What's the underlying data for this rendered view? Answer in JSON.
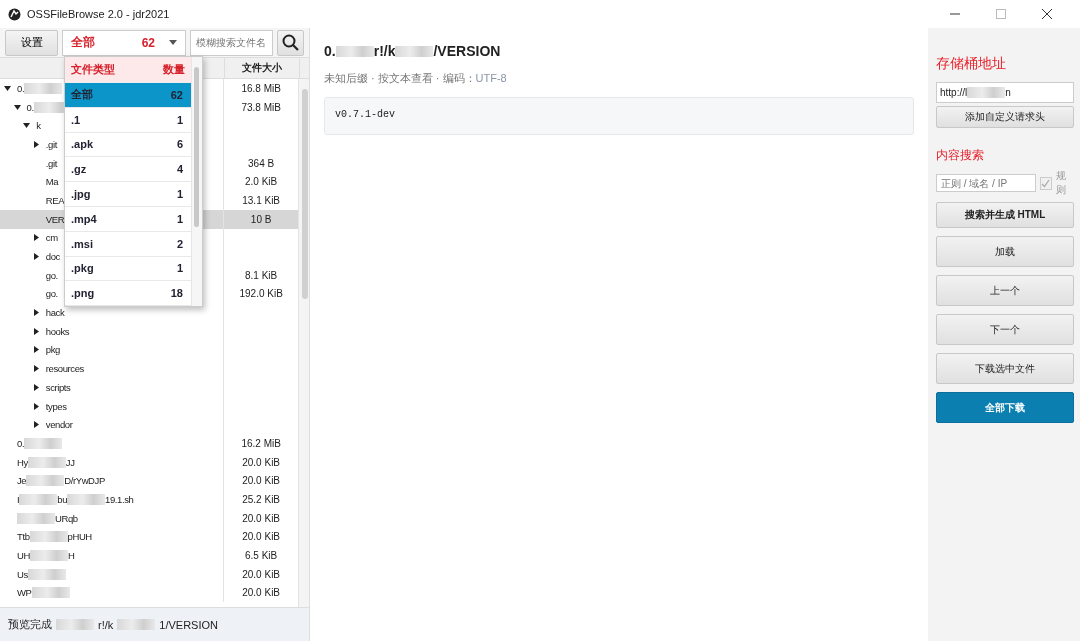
{
  "window": {
    "title": "OSSFileBrowse 2.0 - jdr2021"
  },
  "toolbar": {
    "settings_button": "设置",
    "type_combo": {
      "label": "全部",
      "count": "62"
    },
    "search": {
      "placeholder": "模糊搜索文件名"
    }
  },
  "type_dropdown": {
    "header": {
      "type": "文件类型",
      "count": "数量"
    },
    "items": [
      {
        "type": "全部",
        "count": "62",
        "selected": true
      },
      {
        "type": ".1",
        "count": "1",
        "selected": false
      },
      {
        "type": ".apk",
        "count": "6",
        "selected": false
      },
      {
        "type": ".gz",
        "count": "4",
        "selected": false
      },
      {
        "type": ".jpg",
        "count": "1",
        "selected": false
      },
      {
        "type": ".mp4",
        "count": "1",
        "selected": false
      },
      {
        "type": ".msi",
        "count": "2",
        "selected": false
      },
      {
        "type": ".pkg",
        "count": "1",
        "selected": false
      },
      {
        "type": ".png",
        "count": "18",
        "selected": false
      }
    ]
  },
  "file_table": {
    "columns": [
      "文件大小"
    ],
    "rows": [
      {
        "kind": "folder",
        "expanded": true,
        "selected": false,
        "size": "16.8 MiB",
        "segments": [
          {
            "kind": "text",
            "text": "0."
          },
          {
            "kind": "blur"
          }
        ],
        "children": [
          {
            "kind": "folder",
            "expanded": true,
            "selected": false,
            "size": "73.8 MiB",
            "segments": [
              {
                "kind": "text",
                "text": "0."
              },
              {
                "kind": "blur"
              }
            ],
            "children": [
              {
                "kind": "folder",
                "expanded": true,
                "selected": false,
                "segments": [
                  {
                    "kind": "text",
                    "text": "k"
                  }
                ],
                "children": [
                  {
                    "kind": "folder",
                    "expanded": false,
                    "selected": false,
                    "segments": [
                      {
                        "kind": "text",
                        "text": ".git"
                      }
                    ]
                  },
                  {
                    "kind": "file",
                    "selected": false,
                    "size": "364 B",
                    "segments": [
                      {
                        "kind": "text",
                        "text": ".git"
                      }
                    ]
                  },
                  {
                    "kind": "file",
                    "selected": false,
                    "size": "2.0 KiB",
                    "segments": [
                      {
                        "kind": "text",
                        "text": "Ma"
                      }
                    ]
                  },
                  {
                    "kind": "file",
                    "selected": false,
                    "size": "13.1 KiB",
                    "segments": [
                      {
                        "kind": "text",
                        "text": "REA"
                      }
                    ]
                  },
                  {
                    "kind": "file",
                    "selected": true,
                    "size": "10 B",
                    "segments": [
                      {
                        "kind": "text",
                        "text": "VER"
                      }
                    ]
                  },
                  {
                    "kind": "folder",
                    "expanded": false,
                    "selected": false,
                    "segments": [
                      {
                        "kind": "text",
                        "text": "cm"
                      }
                    ]
                  },
                  {
                    "kind": "folder",
                    "expanded": false,
                    "selected": false,
                    "segments": [
                      {
                        "kind": "text",
                        "text": "doc"
                      }
                    ]
                  },
                  {
                    "kind": "file",
                    "selected": false,
                    "size": "8.1 KiB",
                    "segments": [
                      {
                        "kind": "text",
                        "text": "go."
                      }
                    ]
                  },
                  {
                    "kind": "file",
                    "selected": false,
                    "size": "192.0 KiB",
                    "segments": [
                      {
                        "kind": "text",
                        "text": "go."
                      }
                    ]
                  },
                  {
                    "kind": "folder",
                    "expanded": false,
                    "selected": false,
                    "segments": [
                      {
                        "kind": "text",
                        "text": "hack"
                      }
                    ]
                  },
                  {
                    "kind": "folder",
                    "expanded": false,
                    "selected": false,
                    "segments": [
                      {
                        "kind": "text",
                        "text": "hooks"
                      }
                    ]
                  },
                  {
                    "kind": "folder",
                    "expanded": false,
                    "selected": false,
                    "segments": [
                      {
                        "kind": "text",
                        "text": "pkg"
                      }
                    ]
                  },
                  {
                    "kind": "folder",
                    "expanded": false,
                    "selected": false,
                    "segments": [
                      {
                        "kind": "text",
                        "text": "resources"
                      }
                    ]
                  },
                  {
                    "kind": "folder",
                    "expanded": false,
                    "selected": false,
                    "segments": [
                      {
                        "kind": "text",
                        "text": "scripts"
                      }
                    ]
                  },
                  {
                    "kind": "folder",
                    "expanded": false,
                    "selected": false,
                    "segments": [
                      {
                        "kind": "text",
                        "text": "types"
                      }
                    ]
                  },
                  {
                    "kind": "folder",
                    "expanded": false,
                    "selected": false,
                    "segments": [
                      {
                        "kind": "text",
                        "text": "vendor"
                      }
                    ]
                  }
                ]
              }
            ]
          }
        ]
      },
      {
        "kind": "file",
        "selected": false,
        "size": "16.2 MiB",
        "segments": [
          {
            "kind": "text",
            "text": "0."
          },
          {
            "kind": "blur"
          }
        ]
      },
      {
        "kind": "file",
        "selected": false,
        "size": "20.0 KiB",
        "segments": [
          {
            "kind": "text",
            "text": "Hy"
          },
          {
            "kind": "blur"
          },
          {
            "kind": "text",
            "text": "JJ"
          }
        ]
      },
      {
        "kind": "file",
        "selected": false,
        "size": "20.0 KiB",
        "segments": [
          {
            "kind": "text",
            "text": "Je"
          },
          {
            "kind": "blur"
          },
          {
            "kind": "text",
            "text": "D/rYwDJP"
          }
        ]
      },
      {
        "kind": "file",
        "selected": false,
        "size": "25.2 KiB",
        "segments": [
          {
            "kind": "text",
            "text": "I"
          },
          {
            "kind": "blur"
          },
          {
            "kind": "text",
            "text": "bu"
          },
          {
            "kind": "blur"
          },
          {
            "kind": "text",
            "text": "19.1.sh"
          }
        ]
      },
      {
        "kind": "file",
        "selected": false,
        "size": "20.0 KiB",
        "segments": [
          {
            "kind": "blur"
          },
          {
            "kind": "text",
            "text": "URqb"
          }
        ]
      },
      {
        "kind": "file",
        "selected": false,
        "size": "20.0 KiB",
        "segments": [
          {
            "kind": "text",
            "text": "Ttb"
          },
          {
            "kind": "blur"
          },
          {
            "kind": "text",
            "text": "pHUH"
          }
        ]
      },
      {
        "kind": "file",
        "selected": false,
        "size": "6.5 KiB",
        "segments": [
          {
            "kind": "text",
            "text": "UH"
          },
          {
            "kind": "blur"
          },
          {
            "kind": "text",
            "text": "H"
          }
        ]
      },
      {
        "kind": "file",
        "selected": false,
        "size": "20.0 KiB",
        "segments": [
          {
            "kind": "text",
            "text": "Us"
          },
          {
            "kind": "blur"
          }
        ]
      },
      {
        "kind": "file",
        "selected": false,
        "size": "20.0 KiB",
        "segments": [
          {
            "kind": "text",
            "text": "WP"
          },
          {
            "kind": "blur"
          }
        ]
      }
    ]
  },
  "status_bar": {
    "label": "预览完成",
    "segments": [
      {
        "kind": "blur"
      },
      {
        "kind": "text",
        "text": "r!/k"
      },
      {
        "kind": "blur"
      },
      {
        "kind": "text",
        "text": "1/VERSION"
      }
    ]
  },
  "preview": {
    "title_segments": [
      {
        "kind": "text",
        "text": "0."
      },
      {
        "kind": "blur"
      },
      {
        "kind": "text",
        "text": "r!/k"
      },
      {
        "kind": "blur"
      },
      {
        "kind": "text",
        "text": "/VERSION"
      }
    ],
    "meta": "未知后缀 · 按文本查看 · 编码：",
    "encoding": "UTF-8",
    "content": "v0.7.1-dev"
  },
  "side_panel": {
    "bucket_title": "存储桶地址",
    "bucket_segments": [
      {
        "kind": "text",
        "text": "http://l"
      },
      {
        "kind": "blur"
      },
      {
        "kind": "text",
        "text": "n"
      }
    ],
    "add_header_button": "添加自定义请求头",
    "search_title": "内容搜索",
    "search_placeholder": "正则 / 域名 / IP",
    "regex": {
      "label": "规则",
      "checked": true
    },
    "buttons": [
      {
        "label": "搜索并生成 HTML",
        "kind": "bold"
      },
      {
        "label": "加载",
        "kind": "normal"
      },
      {
        "label": "上一个",
        "kind": "normal"
      },
      {
        "label": "下一个",
        "kind": "normal"
      },
      {
        "label": "下载选中文件",
        "kind": "normal"
      },
      {
        "label": "全部下载",
        "kind": "primary"
      }
    ]
  }
}
